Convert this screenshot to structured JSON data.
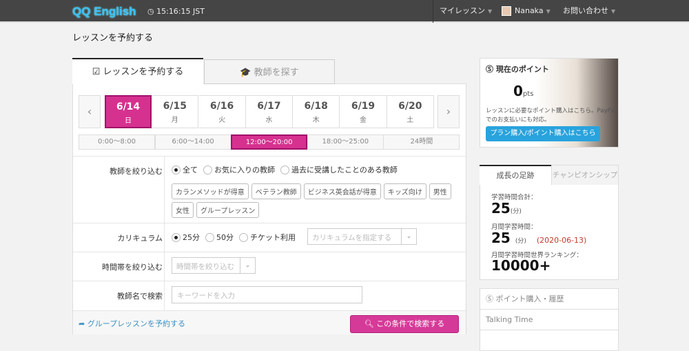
{
  "header": {
    "logo": "QQ English",
    "clock": "15:16:15 JST",
    "nav": {
      "my_lessons": "マイレッスン",
      "user": "Nanaka",
      "contact": "お問い合わせ"
    }
  },
  "page_title": "レッスンを予約する",
  "tabs": [
    {
      "label": "レッスンを予約する",
      "active": true
    },
    {
      "label": "教師を探す",
      "active": false
    }
  ],
  "dates": [
    {
      "date": "6/14",
      "dow": "日",
      "selected": true
    },
    {
      "date": "6/15",
      "dow": "月"
    },
    {
      "date": "6/16",
      "dow": "火"
    },
    {
      "date": "6/17",
      "dow": "水"
    },
    {
      "date": "6/18",
      "dow": "木"
    },
    {
      "date": "6/19",
      "dow": "金"
    },
    {
      "date": "6/20",
      "dow": "土"
    }
  ],
  "time_slots": [
    {
      "label": "0:00〜8:00"
    },
    {
      "label": "6:00〜14:00"
    },
    {
      "label": "12:00〜20:00",
      "selected": true
    },
    {
      "label": "18:00〜25:00"
    },
    {
      "label": "24時間"
    }
  ],
  "filters": {
    "teacher": {
      "label": "教師を絞り込む",
      "options": [
        "全て",
        "お気に入りの教師",
        "過去に受講したことのある教師"
      ],
      "selected": "全て",
      "tags": [
        "カランメソッドが得意",
        "ベテラン教師",
        "ビジネス英会話が得意",
        "キッズ向け",
        "男性",
        "女性",
        "グループレッスン"
      ]
    },
    "curriculum": {
      "label": "カリキュラム",
      "options": [
        "25分",
        "50分",
        "チケット利用"
      ],
      "selected": "25分",
      "select_placeholder": "カリキュラムを指定する"
    },
    "time": {
      "label": "時間帯を絞り込む",
      "select_placeholder": "時間帯を絞り込む"
    },
    "name": {
      "label": "教師名で検索",
      "placeholder": "キーワードを入力"
    }
  },
  "footer": {
    "group_link": "グループレッスンを予約する",
    "search_button": "この条件で検索する"
  },
  "sidebar": {
    "points": {
      "title": "現在のポイント",
      "value": "0",
      "unit": "pts",
      "desc": "レッスンに必要なポイント購入はこちら。PayPalでのお支払いにも対応。",
      "button": "プラン購入/ポイント購入はこちら"
    },
    "growth": {
      "tabs": [
        "成長の足跡",
        "チャンピオンシップ"
      ],
      "total_label": "学習時間合計：",
      "total_value": "25",
      "unit": "(分)",
      "monthly_label": "月間学習時間：",
      "monthly_value": "25",
      "monthly_date": "(2020-06-13)",
      "ranking_label": "月間学習時間世界ランキング：",
      "ranking_value": "10000+"
    },
    "menu": [
      "ポイント購入・履歴",
      "Talking Time"
    ]
  },
  "colors": {
    "accent": "#d6318f",
    "header": "#454545",
    "link": "#3a8fc2",
    "button_blue": "#29a3dd",
    "date_red": "#c0392b"
  }
}
